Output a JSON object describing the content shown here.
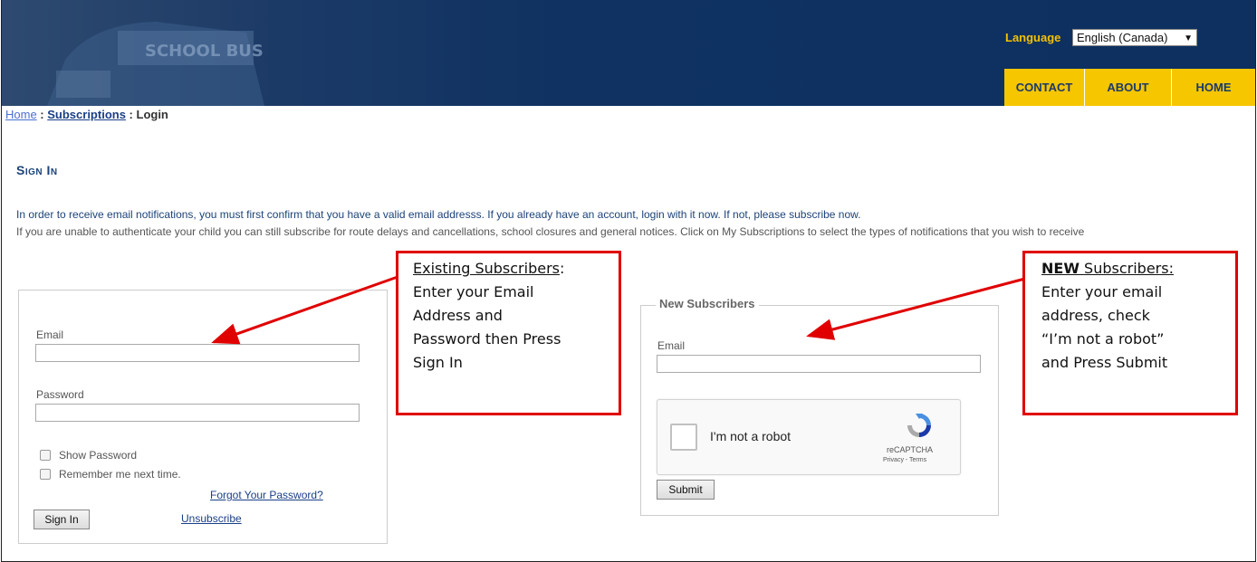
{
  "header": {
    "bus_sign": "SCHOOL BUS",
    "language_label": "Language",
    "language_value": "English (Canada)",
    "nav": [
      "CONTACT",
      "ABOUT",
      "HOME"
    ]
  },
  "breadcrumb": {
    "home": "Home",
    "sep1": " : ",
    "subscriptions": "Subscriptions",
    "sep2": " : ",
    "current": "Login"
  },
  "main": {
    "title": "Sign In",
    "intro1": "In order to receive email notifications, you must first confirm that you have a valid email addresss. If you already have an account, login with it now. If not, please subscribe now.",
    "intro2": "If you are unable to authenticate your child you can still subscribe for route delays and cancellations, school closures and general notices. Click on My Subscriptions to select the types of notifications that you wish to receive"
  },
  "login": {
    "email_label": "Email",
    "email_value": "",
    "password_label": "Password",
    "password_value": "",
    "show_password": "Show Password",
    "remember_me": "Remember me next time.",
    "forgot_link": "Forgot Your Password?",
    "signin_button": "Sign In",
    "unsubscribe_link": "Unsubscribe"
  },
  "new_subscribers": {
    "legend": "New Subscribers",
    "email_label": "Email",
    "email_value": "",
    "recaptcha_text": "I'm not a robot",
    "recaptcha_brand": "reCAPTCHA",
    "recaptcha_terms": "Privacy - Terms",
    "submit_button": "Submit"
  },
  "callouts": {
    "existing_heading": "Existing Subscribers",
    "existing_colon": ":",
    "existing_lines": [
      "Enter your Email",
      "Address and",
      "Password then Press",
      "Sign In"
    ],
    "new_bold": "NEW",
    "new_heading_rest": " Subscribers:",
    "new_lines": [
      "Enter your email",
      "address, check",
      "“I’m not a robot”",
      "and Press Submit"
    ]
  },
  "colors": {
    "header_bg": "#0f3262",
    "nav_bg": "#f6c600",
    "accent_gold": "#f4c000",
    "link_blue": "#1a3f86",
    "callout_red": "#e00000"
  }
}
